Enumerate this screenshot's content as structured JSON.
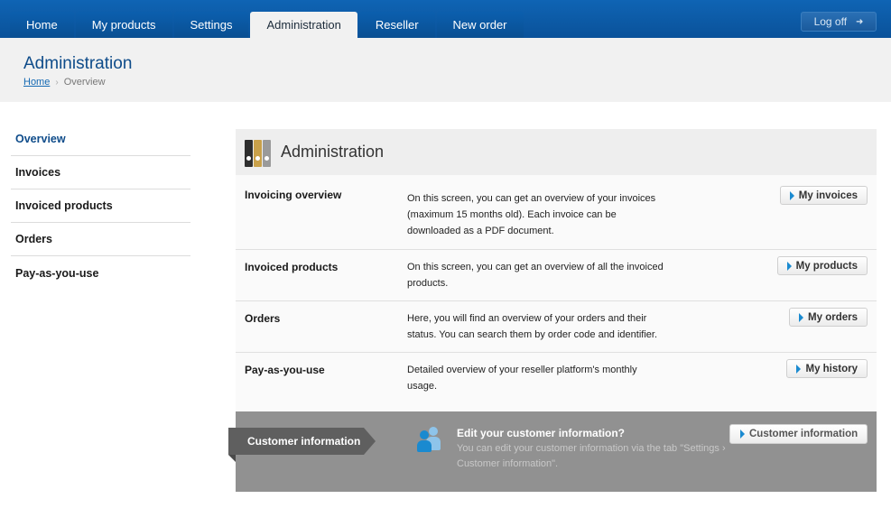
{
  "nav": {
    "tabs": [
      {
        "label": "Home",
        "active": false
      },
      {
        "label": "My products",
        "active": false
      },
      {
        "label": "Settings",
        "active": false
      },
      {
        "label": "Administration",
        "active": true
      },
      {
        "label": "Reseller",
        "active": false
      },
      {
        "label": "New order",
        "active": false
      }
    ],
    "logoff_label": "Log off"
  },
  "header": {
    "title": "Administration",
    "breadcrumb": {
      "home": "Home",
      "current": "Overview"
    }
  },
  "sidebar": {
    "items": [
      {
        "label": "Overview",
        "active": true
      },
      {
        "label": "Invoices",
        "active": false
      },
      {
        "label": "Invoiced products",
        "active": false
      },
      {
        "label": "Orders",
        "active": false
      },
      {
        "label": "Pay-as-you-use",
        "active": false
      }
    ]
  },
  "panel": {
    "title": "Administration",
    "icon": "binders-icon",
    "rows": [
      {
        "title": "Invoicing overview",
        "description": "On this screen, you can get an overview of your invoices (maximum 15 months old). Each invoice can be downloaded as a PDF document.",
        "button": "My invoices"
      },
      {
        "title": "Invoiced products",
        "description": "On this screen, you can get an overview of all the invoiced products.",
        "button": "My products"
      },
      {
        "title": "Orders",
        "description": "Here, you will find an overview of your orders and their status. You can search them by order code and identifier.",
        "button": "My orders"
      },
      {
        "title": "Pay-as-you-use",
        "description": "Detailed overview of your reseller platform's monthly usage.",
        "button": "My history"
      }
    ]
  },
  "customer_info": {
    "ribbon_label": "Customer information",
    "title": "Edit your customer information?",
    "description": "You can edit your customer information via the tab \"Settings › Customer information\".",
    "button": "Customer information"
  },
  "colors": {
    "nav_blue": "#0a5aa6",
    "title_blue": "#0f4c8a",
    "accent_blue": "#1a8ad0",
    "panel_grey": "#919191"
  }
}
